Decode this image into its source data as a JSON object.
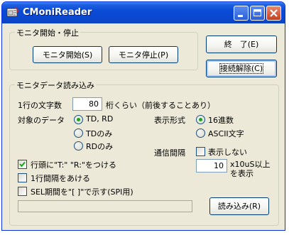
{
  "window": {
    "title": "CMoniReader"
  },
  "monitor_group": {
    "legend": "モニタ開始・停止",
    "start_label": "モニタ開始(S)",
    "stop_label": "モニタ停止(P)"
  },
  "end_label": "終　了(E)",
  "disconnect_label": "接続解除(C)",
  "read_group": {
    "legend": "モニタデータ読み込み",
    "chars_label": "1行の文字数",
    "chars_value": "80",
    "chars_suffix": "桁くらい（前後することあり）",
    "target_label": "対象のデータ",
    "target_options": [
      "TD, RD",
      "TDのみ",
      "RDのみ"
    ],
    "format_label": "表示形式",
    "format_options": [
      "16進数",
      "ASCII文字"
    ],
    "interval_label": "通信間隔",
    "interval_check": "表示しない",
    "interval_value": "10",
    "interval_suffix_1": "x10uS以上",
    "interval_suffix_2": "を表示",
    "opt_prefix": "行頭に\"T:\" \"R:\"をつける",
    "opt_blank": "1行間隔をあける",
    "opt_sel": "SEL期間を\"[ ]\"で示す(SPI用)",
    "read_label": "読み込み(R)"
  }
}
